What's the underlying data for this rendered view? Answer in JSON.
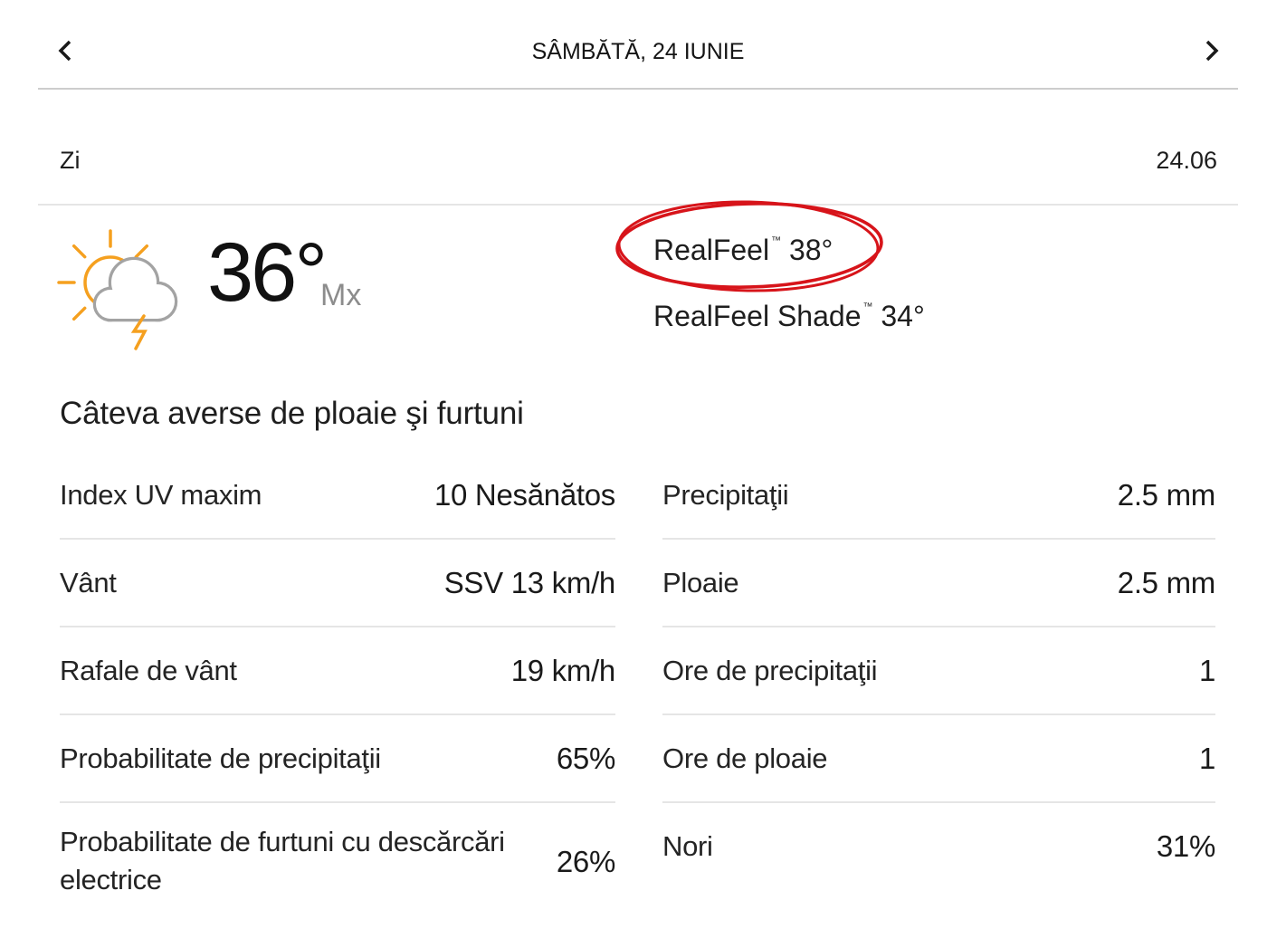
{
  "nav": {
    "prev_icon": "chevron-left-icon",
    "title": "SÂMBĂTĂ, 24 IUNIE",
    "next_icon": "chevron-right-icon"
  },
  "period": {
    "label": "Zi",
    "date": "24.06"
  },
  "current": {
    "icon": "partly-sunny-thunderstorm-icon",
    "temperature": "36°",
    "temperature_qualifier": "Mx",
    "realfeel": {
      "label": "RealFeel",
      "trademark": "™",
      "value": "38°"
    },
    "realfeel_shade": {
      "label": "RealFeel Shade",
      "trademark": "™",
      "value": "34°"
    }
  },
  "condition": "Câteva averse de ploaie şi furtuni",
  "details": {
    "left": [
      {
        "label": "Index UV maxim",
        "value": "10 Nesănătos"
      },
      {
        "label": "Vânt",
        "value": "SSV 13 km/h"
      },
      {
        "label": "Rafale de vânt",
        "value": "19 km/h"
      },
      {
        "label": "Probabilitate de precipitaţii",
        "value": "65%"
      },
      {
        "label": "Probabilitate de furtuni cu descărcări electrice",
        "value": "26%"
      }
    ],
    "right": [
      {
        "label": "Precipitaţii",
        "value": "2.5 mm"
      },
      {
        "label": "Ploaie",
        "value": "2.5 mm"
      },
      {
        "label": "Ore de precipitaţii",
        "value": "1"
      },
      {
        "label": "Ore de ploaie",
        "value": "1"
      },
      {
        "label": "Nori",
        "value": "31%"
      }
    ]
  },
  "colors": {
    "accent": "#f5a01f",
    "cloud": "#a3a3a3",
    "annotation": "#d7141a",
    "text": "#1e1e1e",
    "muted": "#8c8c8c",
    "divider": "#cdcdcd",
    "row_divider": "#e5e5e5"
  }
}
